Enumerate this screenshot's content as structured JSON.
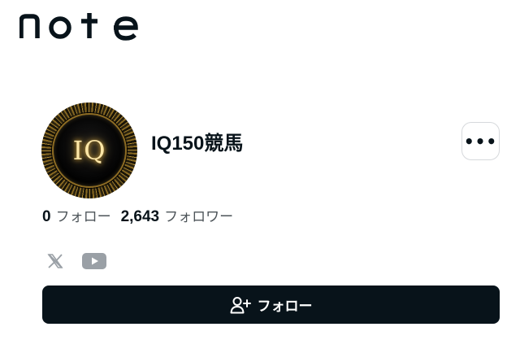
{
  "header": {
    "logo_text": "note"
  },
  "profile": {
    "avatar_text": "IQ",
    "name": "IQ150競馬",
    "more_label": "•••"
  },
  "stats": {
    "following_count": "0",
    "following_label": "フォロー",
    "followers_count": "2,643",
    "followers_label": "フォロワー"
  },
  "social": {
    "items": [
      "x-icon",
      "youtube-icon"
    ]
  },
  "follow_button": {
    "label": "フォロー",
    "icon": "user-plus-icon"
  },
  "colors": {
    "primary": "#08131a",
    "muted": "#4d5459",
    "border": "#d6d9dc",
    "icon_gray": "#9aa0a6"
  }
}
